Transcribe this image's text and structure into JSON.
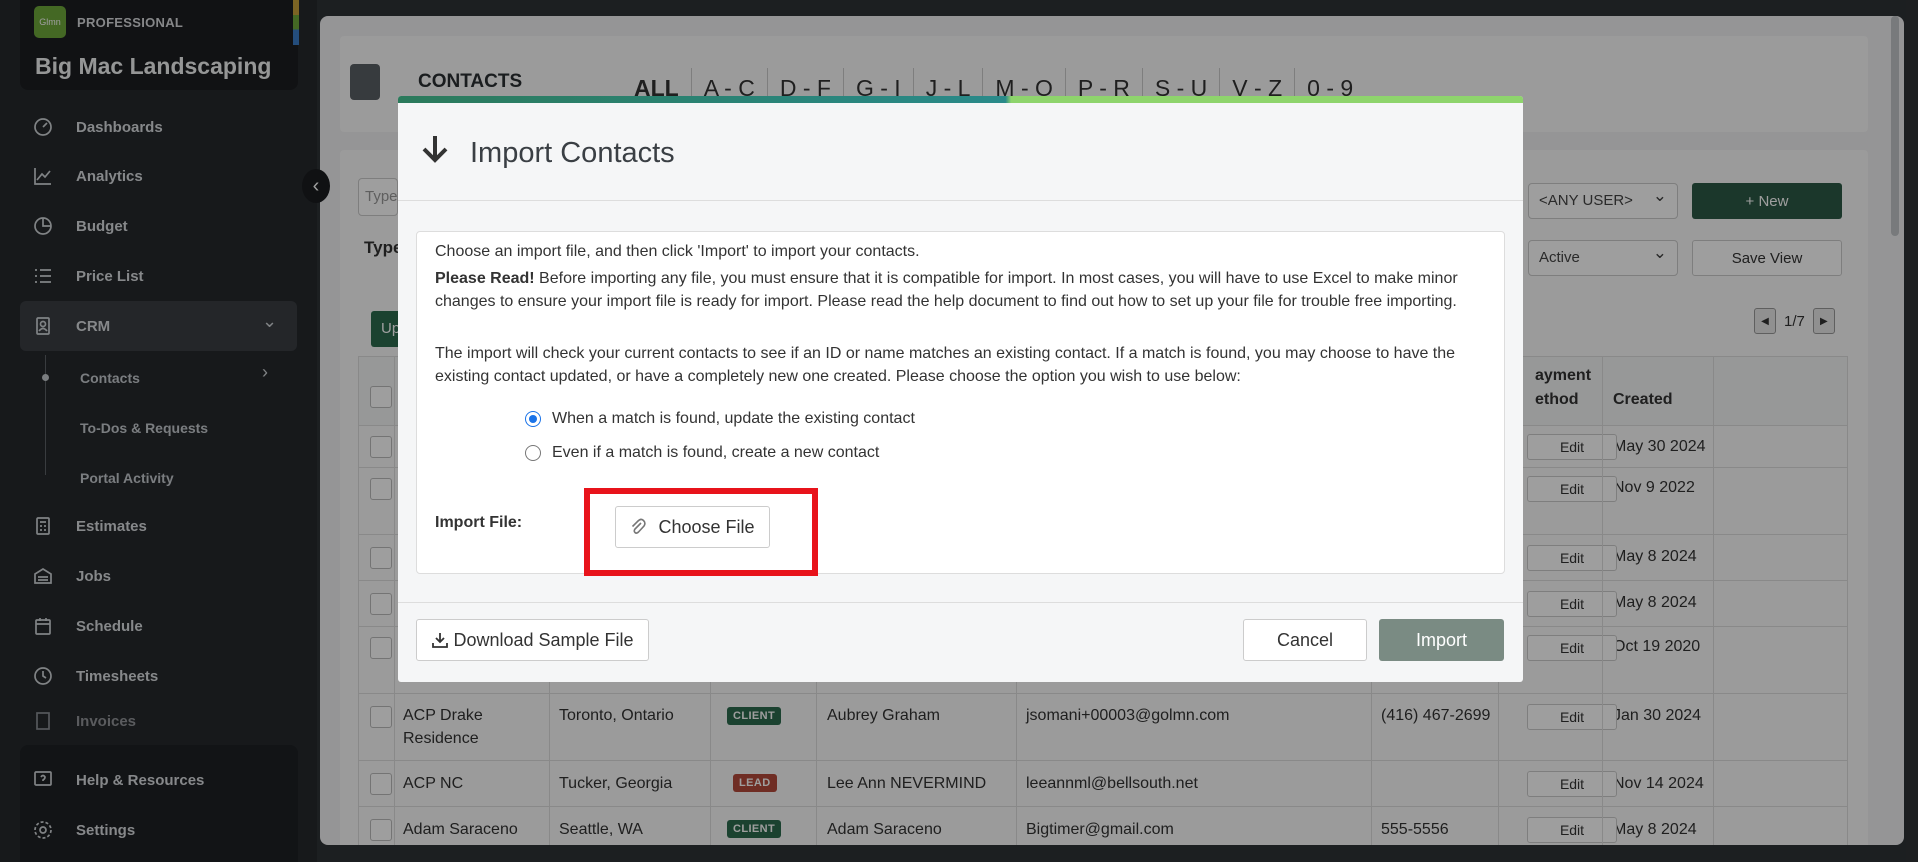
{
  "sidebar": {
    "brand_logo": "Glmn",
    "brand_tier": "PROFESSIONAL",
    "company": "Big Mac Landscaping",
    "items": [
      {
        "label": "Dashboards",
        "icon": "dashboard-icon"
      },
      {
        "label": "Analytics",
        "icon": "analytics-icon"
      },
      {
        "label": "Budget",
        "icon": "budget-icon"
      },
      {
        "label": "Price List",
        "icon": "price-list-icon"
      },
      {
        "label": "CRM",
        "icon": "crm-icon"
      },
      {
        "label": "Estimates",
        "icon": "estimates-icon"
      },
      {
        "label": "Jobs",
        "icon": "jobs-icon"
      },
      {
        "label": "Schedule",
        "icon": "schedule-icon"
      },
      {
        "label": "Timesheets",
        "icon": "timesheets-icon"
      },
      {
        "label": "Invoices",
        "icon": "invoices-icon"
      }
    ],
    "crm_sub": [
      "Contacts",
      "To-Dos & Requests",
      "Portal Activity"
    ],
    "bottom": [
      {
        "label": "Help & Resources",
        "icon": "help-icon"
      },
      {
        "label": "Settings",
        "icon": "settings-icon"
      }
    ]
  },
  "page": {
    "title": "CONTACTS",
    "letters": [
      "ALL",
      "A - C",
      "D - F",
      "G - I",
      "J - L",
      "M - O",
      "P - R",
      "S - U",
      "V - Z",
      "0 - 9"
    ],
    "filter_placeholder": "Type",
    "type_label": "Type",
    "green_button": "Up",
    "user_select": "<ANY USER>",
    "status_select": "Active",
    "new_button": "New",
    "save_view_button": "Save View",
    "pager_text": "1/7"
  },
  "table": {
    "headers": {
      "payment_method": "ayment\nethod",
      "payment_line1": "ayment",
      "payment_line2": "ethod",
      "created": "Created"
    },
    "edit_label": "Edit",
    "rows": [
      {
        "name": "",
        "location": "",
        "badge": "",
        "contact": "",
        "email": "",
        "phone": "",
        "created": "May 30 2024"
      },
      {
        "name": "",
        "location": "",
        "badge": "",
        "contact": "",
        "email": "",
        "phone": "",
        "created": "Nov 9 2022"
      },
      {
        "name": "",
        "location": "",
        "badge": "",
        "contact": "",
        "email": "",
        "phone": "",
        "created": "May 8 2024"
      },
      {
        "name": "",
        "location": "",
        "badge": "",
        "contact": "",
        "email": "",
        "phone": "",
        "created": "May 8 2024"
      },
      {
        "name": "",
        "location": "",
        "badge": "",
        "contact": "",
        "email": "",
        "phone": "",
        "created": "Oct 19 2020"
      },
      {
        "name_line1": "ACP Drake",
        "name_line2": "Residence",
        "location": "Toronto, Ontario",
        "badge": "CLIENT",
        "contact": "Aubrey Graham",
        "email": "jsomani+00003@golmn.com",
        "phone": "(416) 467-2699",
        "created": "Jan 30 2024"
      },
      {
        "name": "ACP NC",
        "location": "Tucker, Georgia",
        "badge": "LEAD",
        "contact": "Lee Ann NEVERMIND",
        "email": "leeannml@bellsouth.net",
        "phone": "",
        "created": "Nov 14 2024"
      },
      {
        "name": "Adam Saraceno",
        "location": "Seattle, WA",
        "badge": "CLIENT",
        "contact": "Adam Saraceno",
        "email": "Bigtimer@gmail.com",
        "phone": "555-5556",
        "created": "May 8 2024"
      }
    ]
  },
  "modal": {
    "title": "Import Contacts",
    "intro": "Choose an import file, and then click 'Import' to import your contacts.",
    "please_read_bold": "Please Read!",
    "please_read_text": " Before importing any file, you must ensure that it is compatible for import. In most cases, you will have to use Excel to make minor changes to ensure your import file is ready for import. Please read the help document to find out how to set up your file for trouble free importing.",
    "match_text": "The import will check your current contacts to see if an ID or name matches an existing contact. If a match is found, you may choose to have the existing contact updated, or have a completely new one created. Please choose the option you wish to use below:",
    "option_update": "When a match is found, update the existing contact",
    "option_create": "Even if a match is found, create a new contact",
    "selected_option": "update",
    "import_file_label": "Import File:",
    "choose_file": "Choose File",
    "download_sample": "Download Sample File",
    "cancel": "Cancel",
    "import": "Import"
  },
  "colors": {
    "accent_green": "#2d5a46",
    "highlight_red": "#e8131b",
    "client_badge": "#2d6b4e",
    "lead_badge": "#b44a3a",
    "import_button": "#7a8b83"
  }
}
